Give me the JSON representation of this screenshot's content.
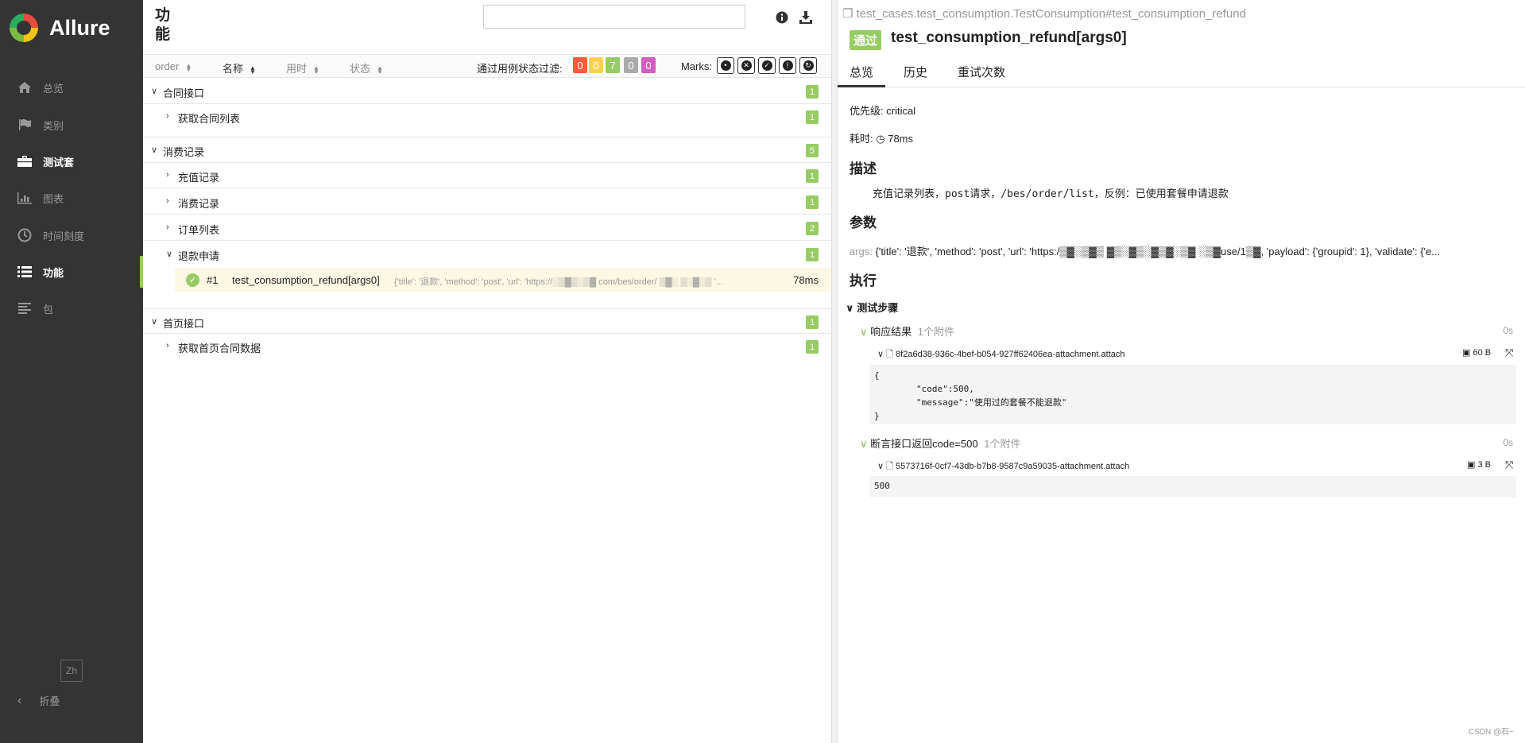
{
  "brand": {
    "name": "Allure"
  },
  "nav": [
    {
      "label": "总览",
      "icon": "home-icon"
    },
    {
      "label": "类别",
      "icon": "flag-icon"
    },
    {
      "label": "测试套",
      "icon": "briefcase-icon"
    },
    {
      "label": "图表",
      "icon": "bar-chart-icon"
    },
    {
      "label": "时间刻度",
      "icon": "clock-icon"
    },
    {
      "label": "功能",
      "icon": "list-icon"
    },
    {
      "label": "包",
      "icon": "align-left-icon"
    }
  ],
  "sidebar": {
    "lang": "Zh",
    "collapse": "折叠"
  },
  "mid": {
    "title": "功能",
    "search_placeholder": "",
    "sort": [
      "order",
      "名称",
      "用时",
      "状态"
    ],
    "filter_label": "通过用例状态过滤:",
    "status_counts": [
      {
        "value": "0",
        "color": "#fd5a3e"
      },
      {
        "value": "0",
        "color": "#ffd050"
      },
      {
        "value": "7",
        "color": "#97cc64"
      },
      {
        "value": "0",
        "color": "#aaaaaa"
      },
      {
        "value": "0",
        "color": "#d35ebe"
      }
    ],
    "marks_label": "Marks:",
    "tree": [
      {
        "label": "合同接口",
        "count": "1"
      },
      {
        "label": "获取合同列表",
        "count": "1"
      },
      {
        "label": "消费记录",
        "count": "5"
      },
      {
        "label": "充值记录",
        "count": "1"
      },
      {
        "label": "消费记录",
        "count": "1"
      },
      {
        "label": "订单列表",
        "count": "2"
      },
      {
        "label": "退款申请",
        "count": "1"
      },
      {
        "label": "首页接口",
        "count": "1"
      },
      {
        "label": "获取首页合同数据",
        "count": "1"
      }
    ],
    "test": {
      "num": "#1",
      "name": "test_consumption_refund[args0]",
      "args": "{'title': '退款', 'method': 'post', 'url': 'https://░▒▓▒░▒▓ com/bes/order/ ▒▓░ ▒░▓░▒ '...",
      "duration": "78ms"
    }
  },
  "detail": {
    "path": "test_cases.test_consumption.TestConsumption#test_consumption_refund",
    "status": "通过",
    "title": "test_consumption_refund[args0]",
    "tabs": [
      "总览",
      "历史",
      "重试次数"
    ],
    "severity_label": "优先级:",
    "severity": "critical",
    "duration_label": "耗时:",
    "duration": "78ms",
    "desc_heading": "描述",
    "description": "充值记录列表，post请求，/bes/order/list，反例：已使用套餐申请退款",
    "params_heading": "参数",
    "args_label": "args:",
    "args_value": "{'title': '退款', 'method': 'post', 'url': 'https:/▒▓░▒▓▒ ▓▒░▓▒░▓▒▓░▒▓ ░▒▓use/1▒▓, 'payload': {'groupid': 1}, 'validate': {'e...",
    "exec_heading": "执行",
    "steps_label": "测试步骤",
    "step1": {
      "name": "响应结果",
      "attach_count": "1个附件",
      "time": "0s"
    },
    "attach1": {
      "name": "8f2a6d38-936c-4bef-b054-927ff62406ea-attachment.attach",
      "size": "60 B"
    },
    "code": [
      "{",
      "        \"code\":500,",
      "        \"message\":\"使用过的套餐不能退款\"",
      "}"
    ],
    "step2": {
      "name": "断言接口返回code=500",
      "attach_count": "1个附件",
      "time": "0s"
    },
    "attach2": {
      "name": "5573716f-0cf7-43db-b7b8-9587c9a59035-attachment.attach",
      "size": "3 B"
    },
    "attach2_content": "500"
  },
  "footer": "CSDN @石~"
}
